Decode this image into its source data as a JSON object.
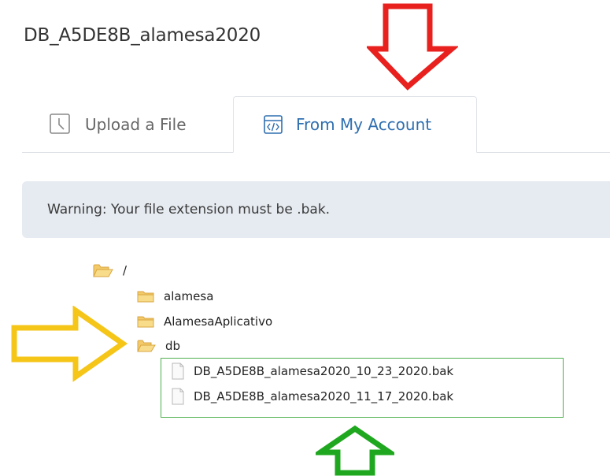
{
  "page": {
    "title": "DB_A5DE8B_alamesa2020"
  },
  "tabs": [
    {
      "label": "Upload a File",
      "icon": "clock-icon",
      "active": false
    },
    {
      "label": "From My Account",
      "icon": "code-window-icon",
      "active": true
    }
  ],
  "warning": {
    "text": "Warning: Your file extension must be .bak."
  },
  "tree": {
    "root": {
      "label": "/",
      "icon": "folder-open-icon"
    },
    "folders": [
      {
        "label": "alamesa",
        "icon": "folder-icon"
      },
      {
        "label": "AlamesaAplicativo",
        "icon": "folder-icon"
      },
      {
        "label": "db",
        "icon": "folder-open-icon"
      }
    ],
    "files": [
      {
        "label": "DB_A5DE8B_alamesa2020_10_23_2020.bak",
        "icon": "file-icon"
      },
      {
        "label": "DB_A5DE8B_alamesa2020_11_17_2020.bak",
        "icon": "file-icon"
      }
    ]
  },
  "annotations": {
    "red_arrow_color": "#e8201e",
    "yellow_arrow_color": "#f5c518",
    "green_arrow_color": "#1fa81f",
    "box_color": "#4fb04f"
  }
}
